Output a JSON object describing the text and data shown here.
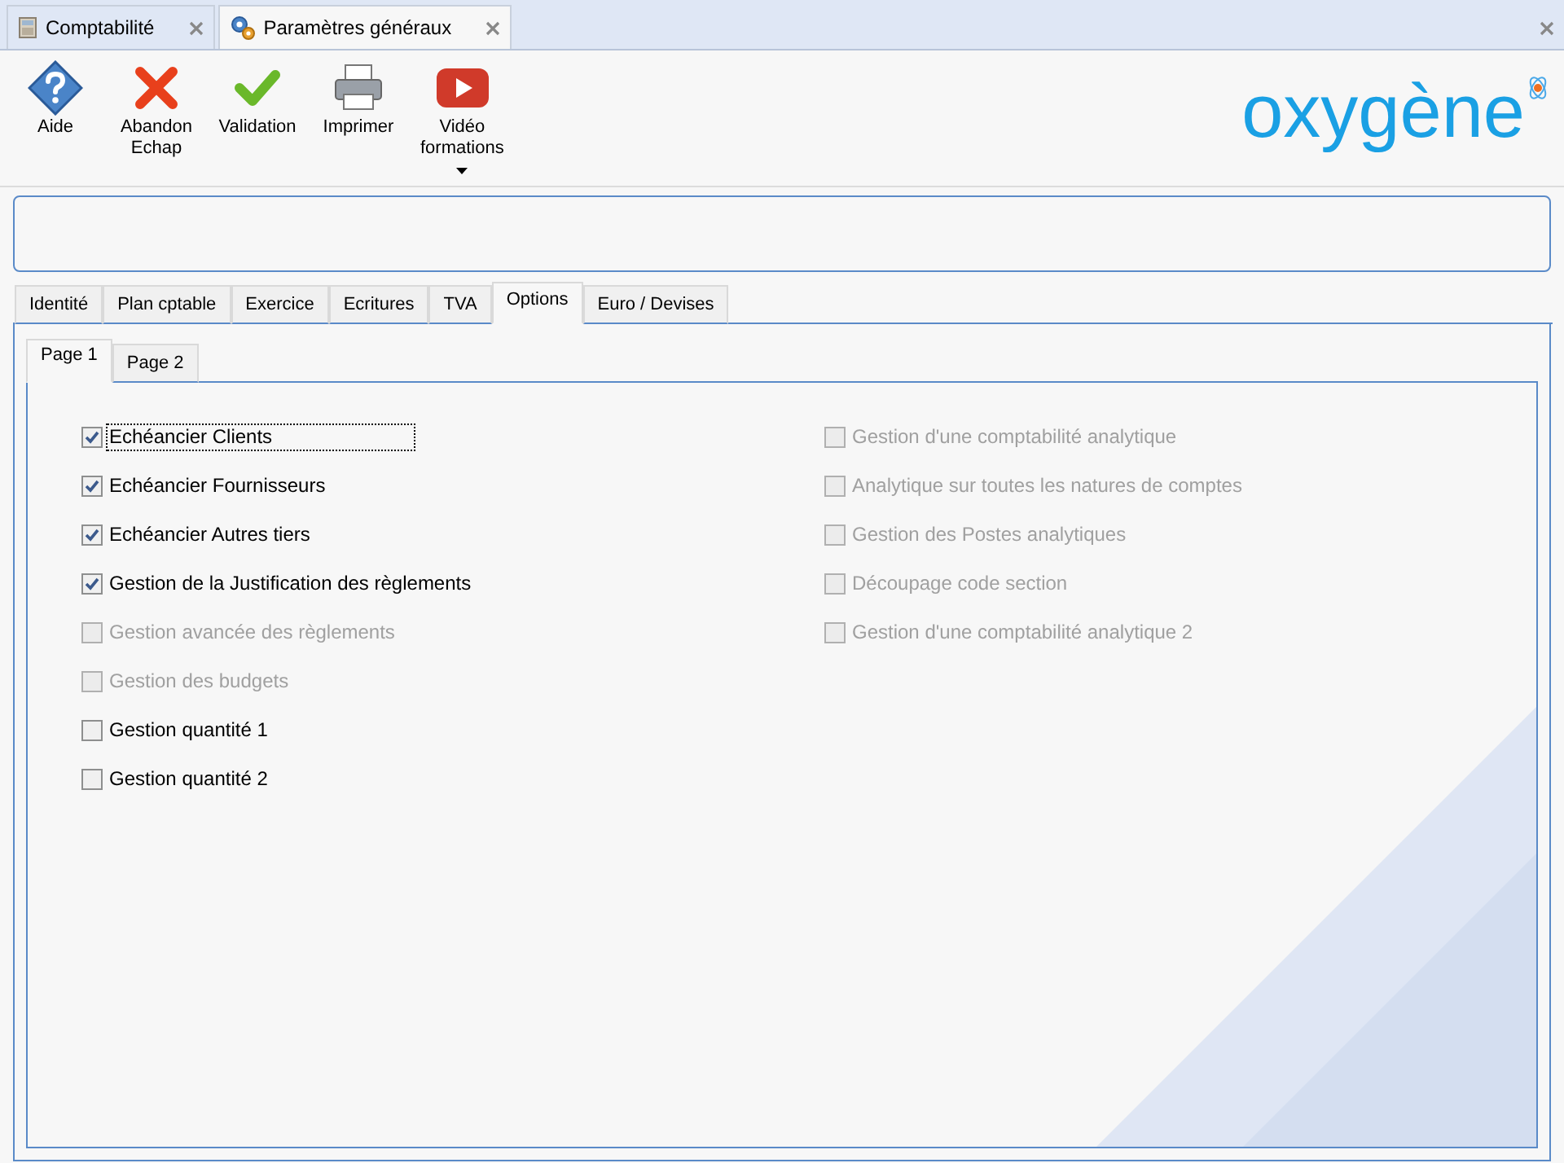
{
  "doc_tabs": [
    {
      "label": "Comptabilité",
      "selected": false,
      "kind": "ledger"
    },
    {
      "label": "Paramètres généraux",
      "selected": true,
      "kind": "gears"
    }
  ],
  "toolbar": [
    {
      "label": "Aide",
      "kind": "help"
    },
    {
      "label": "Abandon\nEchap",
      "kind": "cancel"
    },
    {
      "label": "Validation",
      "kind": "ok"
    },
    {
      "label": "Imprimer",
      "kind": "print"
    },
    {
      "label": "Vidéo\nformations",
      "kind": "video",
      "dropdown": true
    }
  ],
  "logo": {
    "text": "oxygène"
  },
  "tabs": [
    {
      "label": "Identité",
      "selected": false
    },
    {
      "label": "Plan cptable",
      "selected": false
    },
    {
      "label": "Exercice",
      "selected": false
    },
    {
      "label": "Ecritures",
      "selected": false
    },
    {
      "label": "TVA",
      "selected": false
    },
    {
      "label": "Options",
      "selected": true
    },
    {
      "label": "Euro / Devises",
      "selected": false
    }
  ],
  "sub_tabs": [
    {
      "label": "Page 1",
      "selected": true
    },
    {
      "label": "Page 2",
      "selected": false
    }
  ],
  "options_left": [
    {
      "label": "Echéancier Clients",
      "checked": true,
      "disabled": false,
      "focused": true
    },
    {
      "label": "Echéancier Fournisseurs",
      "checked": true,
      "disabled": false,
      "focused": false
    },
    {
      "label": "Echéancier Autres tiers",
      "checked": true,
      "disabled": false,
      "focused": false
    },
    {
      "label": "Gestion de la Justification des règlements",
      "checked": true,
      "disabled": false,
      "focused": false
    },
    {
      "label": "Gestion avancée des règlements",
      "checked": false,
      "disabled": true,
      "focused": false
    },
    {
      "label": "Gestion des budgets",
      "checked": false,
      "disabled": true,
      "focused": false
    },
    {
      "label": "Gestion quantité 1",
      "checked": false,
      "disabled": false,
      "focused": false
    },
    {
      "label": "Gestion quantité 2",
      "checked": false,
      "disabled": false,
      "focused": false
    }
  ],
  "options_right": [
    {
      "label": "Gestion d'une comptabilité analytique",
      "checked": false,
      "disabled": true,
      "focused": false
    },
    {
      "label": "Analytique sur toutes les natures de comptes",
      "checked": false,
      "disabled": true,
      "focused": false
    },
    {
      "label": "Gestion des Postes analytiques",
      "checked": false,
      "disabled": true,
      "focused": false
    },
    {
      "label": "Découpage code section",
      "checked": false,
      "disabled": true,
      "focused": false
    },
    {
      "label": "Gestion d'une comptabilité analytique 2",
      "checked": false,
      "disabled": true,
      "focused": false
    }
  ]
}
